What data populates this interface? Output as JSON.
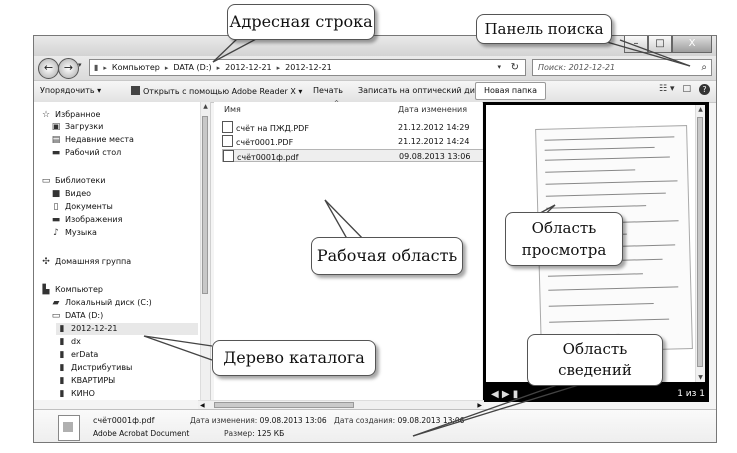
{
  "window": {
    "buttons": {
      "minimize": "–",
      "maximize": "□",
      "close": "X"
    }
  },
  "address_bar": {
    "back": "←",
    "forward": "→",
    "crumbs": [
      "Компьютер",
      "DATA (D:)",
      "2012-12-21",
      "2012-12-21"
    ],
    "dropdown": "▾",
    "refresh": "↻"
  },
  "search": {
    "placeholder": "Поиск: 2012-12-21",
    "icon": "search-icon"
  },
  "toolbar": {
    "organize": "Упорядочить ▾",
    "open_with": "Открыть с помощью Adobe Reader X ▾",
    "print": "Печать",
    "burn": "Записать на оптический диск",
    "new_folder": "Новая папка"
  },
  "navigation": {
    "favorites": {
      "label": "Избранное",
      "items": [
        "Загрузки",
        "Недавние места",
        "Рабочий стол"
      ]
    },
    "libraries": {
      "label": "Библиотеки",
      "items": [
        "Видео",
        "Документы",
        "Изображения",
        "Музыка"
      ]
    },
    "homegroup": "Домашняя группа",
    "computer": {
      "label": "Компьютер",
      "drives": [
        "Локальный диск (C:)",
        "DATA (D:)"
      ],
      "folders": [
        "2012-12-21",
        "dx",
        "erData",
        "Дистрибутивы",
        "КВАРТИРЫ",
        "КИНО"
      ]
    }
  },
  "file_list": {
    "columns": {
      "name": "Имя",
      "date": "Дата изменения"
    },
    "files": [
      {
        "name": "счёт на ПЖД.PDF",
        "date": "21.12.2012 14:29"
      },
      {
        "name": "счёт0001.PDF",
        "date": "21.12.2012 14:24"
      },
      {
        "name": "счёт0001ф.pdf",
        "date": "09.08.2013 13:06",
        "selected": true
      }
    ]
  },
  "preview": {
    "page_indicator": "1 из 1"
  },
  "details": {
    "filename": "счёт0001ф.pdf",
    "filetype": "Adobe Acrobat Document",
    "modified_label": "Дата изменения:",
    "modified": "09.08.2013 13:06",
    "created_label": "Дата создания:",
    "created": "09.08.2013 13:06",
    "size_label": "Размер:",
    "size": "125 КБ"
  },
  "annotations": {
    "address": "Адресная строка",
    "search_panel": "Панель поиска",
    "work_area": "Рабочая область",
    "preview_area": [
      "Область",
      "просмотра"
    ],
    "tree": "Дерево каталога",
    "details_area": [
      "Область",
      "сведений"
    ]
  },
  "colors": {
    "callout_border": "#555555",
    "preview_bg": "#000000"
  }
}
